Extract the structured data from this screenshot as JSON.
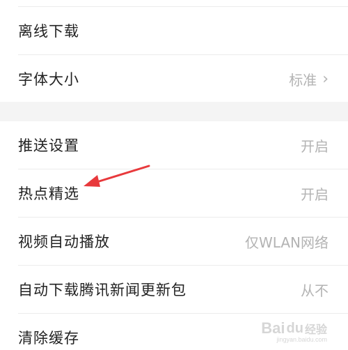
{
  "settings": {
    "items": [
      {
        "label": "离线下载",
        "value": ""
      },
      {
        "label": "字体大小",
        "value": "标准",
        "chevron": "›"
      },
      {
        "label": "推送设置",
        "value": "开启"
      },
      {
        "label": "热点精选",
        "value": "开启"
      },
      {
        "label": "视频自动播放",
        "value": "仅WLAN网络"
      },
      {
        "label": "自动下载腾讯新闻更新包",
        "value": "从不"
      },
      {
        "label": "清除缓存",
        "value": ""
      }
    ]
  },
  "annotation": {
    "icon": "red-arrow-pointer",
    "color": "#e8393c"
  },
  "watermark": {
    "text_a": "Bai",
    "paw": "du",
    "text_b": "经验",
    "url": "jingyan.baidu.com"
  },
  "colors": {
    "label": "#222222",
    "value": "#b3b3b3",
    "gap": "#f4f4f4"
  }
}
